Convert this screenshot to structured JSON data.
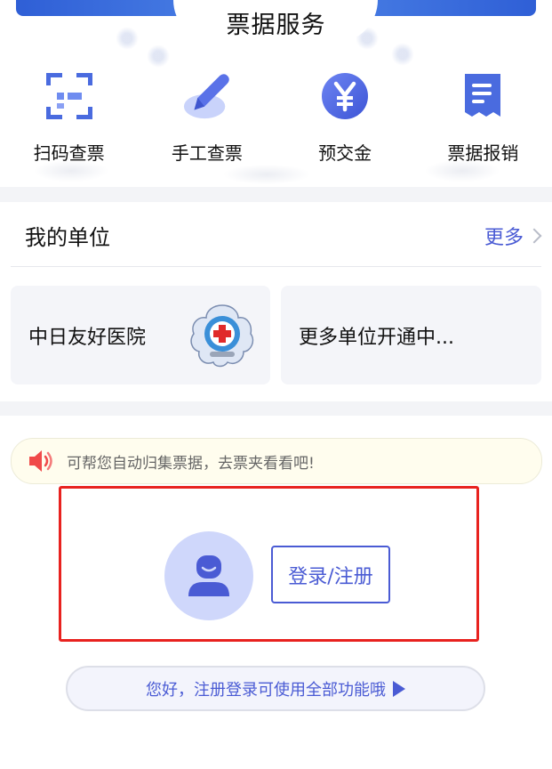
{
  "service": {
    "title": "票据服务",
    "items": [
      {
        "label": "扫码查票",
        "icon": "scan-qr-icon"
      },
      {
        "label": "手工查票",
        "icon": "pen-edit-icon"
      },
      {
        "label": "预交金",
        "icon": "yuan-coin-icon"
      },
      {
        "label": "票据报销",
        "icon": "receipt-icon"
      }
    ]
  },
  "units": {
    "title": "我的单位",
    "more_label": "更多",
    "cards": [
      {
        "name": "中日友好医院",
        "logo": "hospital-logo-icon"
      },
      {
        "name": "更多单位开通中..."
      }
    ]
  },
  "notice": {
    "icon": "speaker-icon",
    "text": "可帮您自动归集票据，去票夹看看吧!"
  },
  "login": {
    "avatar_icon": "user-avatar-icon",
    "button_label": "登录/注册",
    "hint_text": "您好，注册登录可使用全部功能哦"
  },
  "colors": {
    "accent": "#4a5bd4",
    "highlight_border": "#e8221f",
    "notice_bg": "#fffdee",
    "card_bg": "#f4f5f9"
  }
}
